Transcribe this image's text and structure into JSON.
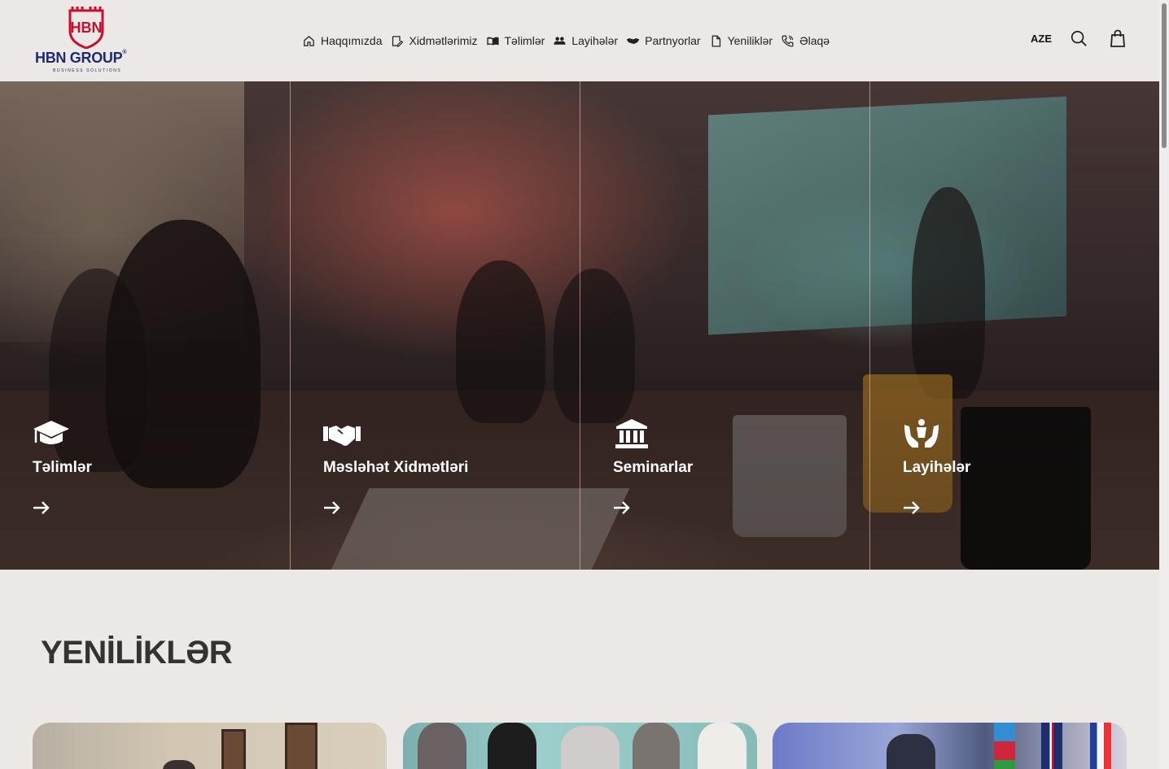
{
  "header": {
    "logo": {
      "name": "HBN GROUP",
      "tagline": "BUSINESS SOLUTIONS",
      "mark": "HBN"
    },
    "nav": [
      {
        "label": "Haqqımızda",
        "icon": "home-icon"
      },
      {
        "label": "Xidmətlərimiz",
        "icon": "edit-icon"
      },
      {
        "label": "Təlimlər",
        "icon": "book-open-icon"
      },
      {
        "label": "Layihələr",
        "icon": "users-icon"
      },
      {
        "label": "Partnyorlar",
        "icon": "handshake-icon"
      },
      {
        "label": "Yeniliklər",
        "icon": "document-icon"
      },
      {
        "label": "Əlaqə",
        "icon": "phone-icon"
      }
    ],
    "language": "AZE",
    "search_icon": "search-icon",
    "cart_icon": "shopping-bag-icon"
  },
  "hero": {
    "panels": [
      {
        "title": "Təlimlər",
        "icon": "graduation-cap-icon"
      },
      {
        "title": "Məsləhət Xidmətləri",
        "icon": "handshake-icon"
      },
      {
        "title": "Seminarlar",
        "icon": "building-columns-icon"
      },
      {
        "title": "Layihələr",
        "icon": "hands-holding-child-icon"
      }
    ],
    "arrow_icon": "arrow-right-icon"
  },
  "news": {
    "title": "YENİLİKLƏR",
    "cards": [
      {
        "image": "news-photo-1"
      },
      {
        "image": "news-photo-2"
      },
      {
        "image": "news-photo-3"
      }
    ]
  },
  "colors": {
    "brand_red": "#c8102e",
    "brand_navy": "#1f2a6e",
    "background": "#ebe8e6"
  }
}
